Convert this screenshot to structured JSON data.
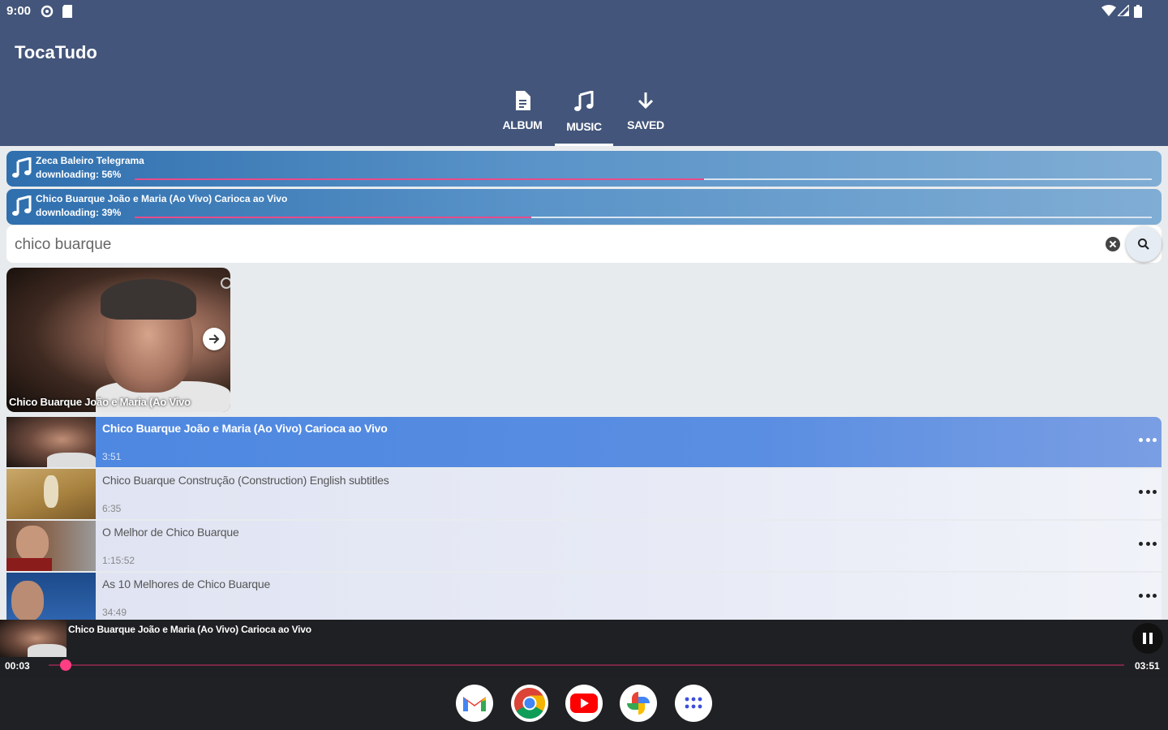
{
  "status_bar": {
    "time": "9:00"
  },
  "app": {
    "title": "TocaTudo"
  },
  "tabs": [
    {
      "label": "ALBUM",
      "icon": "file-icon",
      "active": false
    },
    {
      "label": "MUSIC",
      "icon": "music-note-icon",
      "active": true
    },
    {
      "label": "SAVED",
      "icon": "download-arrow-icon",
      "active": false
    }
  ],
  "downloads": [
    {
      "title": "Zeca Baleiro  Telegrama",
      "status": "downloading: 56%",
      "progress": 0.56
    },
    {
      "title": "Chico Buarque  João e Maria (Ao Vivo)  Carioca ao Vivo",
      "status": "downloading: 39%",
      "progress": 0.39
    }
  ],
  "search": {
    "query": "chico buarque"
  },
  "featured": {
    "caption": "Chico Buarque  João e Maria (Ao Vivo"
  },
  "results": [
    {
      "title": "Chico Buarque  João e Maria (Ao Vivo)  Carioca ao Vivo",
      "duration": "3:51",
      "active": true
    },
    {
      "title": "Chico Buarque  Construção (Construction)  English subtitles",
      "duration": "6:35",
      "active": false
    },
    {
      "title": "O Melhor de Chico Buarque",
      "duration": "1:15:52",
      "active": false
    },
    {
      "title": "As 10 Melhores de Chico Buarque",
      "duration": "34:49",
      "active": false
    }
  ],
  "player": {
    "title": "Chico Buarque  João e Maria (Ao Vivo)  Carioca ao Vivo",
    "elapsed": "00:03",
    "total": "03:51",
    "progress": 0.016
  },
  "dock": [
    "gmail-icon",
    "chrome-icon",
    "youtube-icon",
    "google-photos-icon",
    "app-drawer-icon"
  ],
  "colors": {
    "appbar": "#43557a",
    "accent": "#e84b8a",
    "active_row": "#4c87e0"
  }
}
